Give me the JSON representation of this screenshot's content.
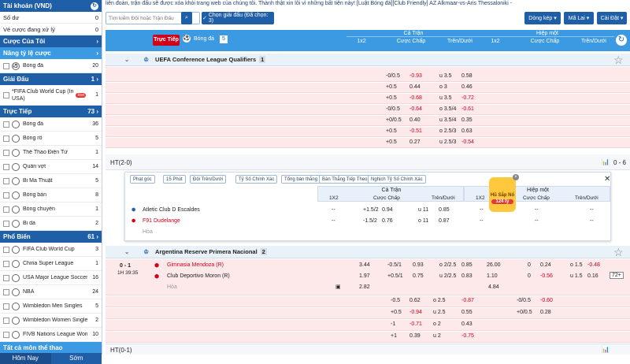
{
  "sidebar": {
    "account": "Tài khoản (VND)",
    "balance_label": "Số dư",
    "balance_val": "0",
    "pending_label": "Vé cược đang xử lý",
    "pending_val": "0",
    "my_bets": "Cược Của Tôi",
    "upgrade": "Nâng tỷ lệ cược",
    "upgrade_item": {
      "label": "Bóng đá",
      "count": "20"
    },
    "tournament": "Giải Đấu",
    "tournament_count": "1",
    "tournament_item": {
      "label": "*FIFA Club World Cup (In USA)",
      "badge": "Hot",
      "count": "1"
    },
    "live": "Trực Tiếp",
    "live_count": "73",
    "live_items": [
      {
        "label": "Bóng đá",
        "count": "36"
      },
      {
        "label": "Bóng rổ",
        "count": "5"
      },
      {
        "label": "Thể Thao Điện Tử",
        "count": "1"
      },
      {
        "label": "Quần vợt",
        "count": "14"
      },
      {
        "label": "Bi Ma Thuật",
        "count": "5"
      },
      {
        "label": "Bóng bàn",
        "count": "8"
      },
      {
        "label": "Bóng chuyền",
        "count": "1"
      },
      {
        "label": "Bi da",
        "count": "2"
      }
    ],
    "popular": "Phổ Biến",
    "popular_count": "61",
    "popular_items": [
      {
        "label": "FIFA Club World Cup",
        "count": "3"
      },
      {
        "label": "China Super League",
        "count": "1"
      },
      {
        "label": "USA Major League Soccer",
        "count": "16"
      },
      {
        "label": "NBA",
        "count": "24"
      },
      {
        "label": "Wimbledon Men Singles",
        "count": "5"
      },
      {
        "label": "Wimbledon Women Singles",
        "count": "2"
      },
      {
        "label": "FIVB Nations League Women",
        "count": "10"
      }
    ],
    "all_sports": "Tất cả môn thể thao",
    "tab_today": "Hôm Nay",
    "tab_early": "Sớm"
  },
  "topbar": {
    "marquee": "liên đoàn, trận đấu sẽ được xóa khỏi trang web của chúng tôi. Thành thật xin lỗi vì những bất tiện này!    [Luật Bóng đá][Club Friendly]  AZ Alkmaar-vs-Aris Thessaloniki - ",
    "search_placeholder": "Tìm kiếm Đội hoặc Trận Đấu",
    "choose_league": "Chọn giải đấu (Đã chọn: 3)",
    "sort": "Dòng kép",
    "odds_type": "Mã Lai",
    "settings": "Cài Đặt"
  },
  "header": {
    "live_btn": "Trực Tiếp",
    "sport": "Bóng đá",
    "sport_count": "5",
    "full": "Cả Trận",
    "half": "Hiệp một",
    "x12": "1x2",
    "hdp": "Cược Chấp",
    "ou": "Trên/Dưới"
  },
  "league1": {
    "name": "UEFA Conference League Qualifiers",
    "count": "1"
  },
  "league1_rows": [
    [
      "-0/0.5",
      "-0.93",
      "u 3.5",
      "0.58"
    ],
    [
      "+0.5",
      "0.44",
      "o 3",
      "0.46"
    ],
    [
      "+0.5",
      "-0.68",
      "u 3.5",
      "-0.72"
    ],
    [
      "-0/0.5",
      "-0.64",
      "o 3.5/4",
      "-0.61"
    ],
    [
      "+0/0.5",
      "0.40",
      "u 3.5/4",
      "0.35"
    ],
    [
      "+0.5",
      "-0.51",
      "o 2.5/3",
      "0.63"
    ],
    [
      "+0.5",
      "0.27",
      "u 2.5/3",
      "-0.54"
    ]
  ],
  "ht1": {
    "label": "HT(2-0)",
    "score": "0 - 6"
  },
  "popup": {
    "chips": [
      "Phạt góc",
      "15 Phút",
      "Đội Trên/Dưới",
      "Tỷ Số Chính Xác",
      "Tổng bàn thắng",
      "Bàn Thắng Tiếp Theo",
      "Nghịch Tỷ Số Chính Xác"
    ],
    "full": "Cả Trận",
    "half": "Hiệp một",
    "x12": "1X2",
    "hdp": "Cược Chấp",
    "ou": "Trên/Dưới",
    "home": "Atletic Club D Escaldes",
    "away": "F91 Dudelange",
    "draw": "Hòa",
    "home_odds": [
      "--",
      "+1.5/2",
      "0.94",
      "u 11",
      "0.85"
    ],
    "away_odds": [
      "--",
      "-1.5/2",
      "0.76",
      "o 11",
      "0.87"
    ],
    "half_home": [
      "--",
      "--",
      "--"
    ],
    "half_away": [
      "--",
      "--",
      "--"
    ],
    "jackpot": "Hũ Sắp Nổ",
    "jackpot_val": "124 tỷ"
  },
  "league2": {
    "name": "Argentina Reserve Primera Nacional",
    "count": "2"
  },
  "match2": {
    "score": "0 - 1",
    "time": "1H 39:35",
    "home": "Gimnasia Mendoza (R)",
    "away": "Club Deportivo Moron (R)",
    "draw": "Hòa",
    "home_odds": [
      "3.44",
      "-0.5/1",
      "0.93",
      "o 2/2.5",
      "0.85",
      "26.00",
      "0",
      "0.24",
      "o 1.5",
      "-0.48"
    ],
    "away_odds": [
      "1.97",
      "+0.5/1",
      "0.75",
      "u 2/2.5",
      "0.83",
      "1.10",
      "0",
      "-0.56",
      "u 1.5",
      "0.16"
    ],
    "draw_odds": [
      "2.82",
      "4.84"
    ],
    "more": "72+"
  },
  "league2_rows": [
    [
      "-0.5",
      "0.62",
      "o 2.5",
      "-0.87",
      "-0/0.5",
      "-0.60"
    ],
    [
      "+0.5",
      "-0.94",
      "u 2.5",
      "0.55",
      "+0/0.5",
      "0.28"
    ],
    [
      "-1",
      "-0.71",
      "o 2",
      "0.43",
      "",
      ""
    ],
    [
      "+1",
      "0.39",
      "u 2",
      "-0.75",
      "",
      ""
    ]
  ],
  "ht2": {
    "label": "HT(0-1)"
  }
}
